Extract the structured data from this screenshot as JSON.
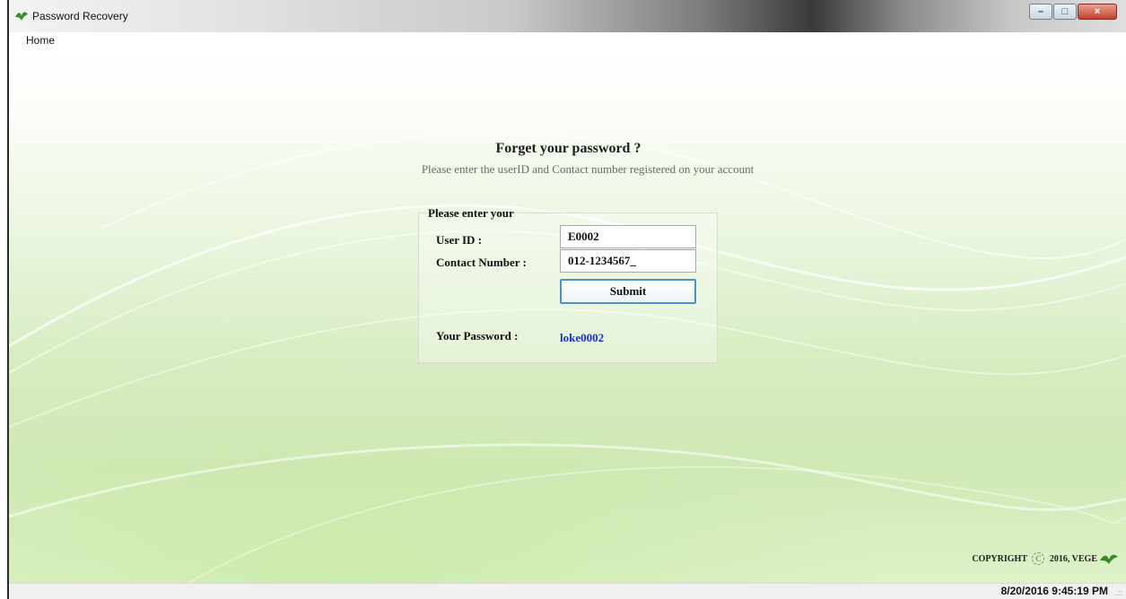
{
  "window": {
    "title": "Password Recovery",
    "controls": {
      "minimize": "–",
      "maximize": "□",
      "close": "×"
    }
  },
  "menu": {
    "home_label": "Home"
  },
  "form": {
    "heading": "Forget your password ?",
    "subheading": "Please enter the userID and Contact number registered on your account",
    "group_title": "Please enter your",
    "user_id_label": "User ID :",
    "user_id_value": "E0002",
    "contact_label": "Contact Number :",
    "contact_value": "012-1234567_",
    "submit_label": "Submit",
    "password_label": "Your Password :",
    "password_value": "loke0002"
  },
  "footer": {
    "copyright_prefix": "COPYRIGHT",
    "copyright_suffix": "2016, VEGE",
    "copyright_symbol": "C"
  },
  "statusbar": {
    "datetime": "8/20/2016 9:45:19 PM",
    "grip": ".::"
  },
  "colors": {
    "accent_green": "#cfe9b4",
    "password_text": "#1c2fd6",
    "button_border": "#4a93c8"
  },
  "icons": [
    "leaf-icon",
    "minimize-icon",
    "maximize-icon",
    "close-icon",
    "copyright-icon",
    "resize-grip-icon"
  ]
}
